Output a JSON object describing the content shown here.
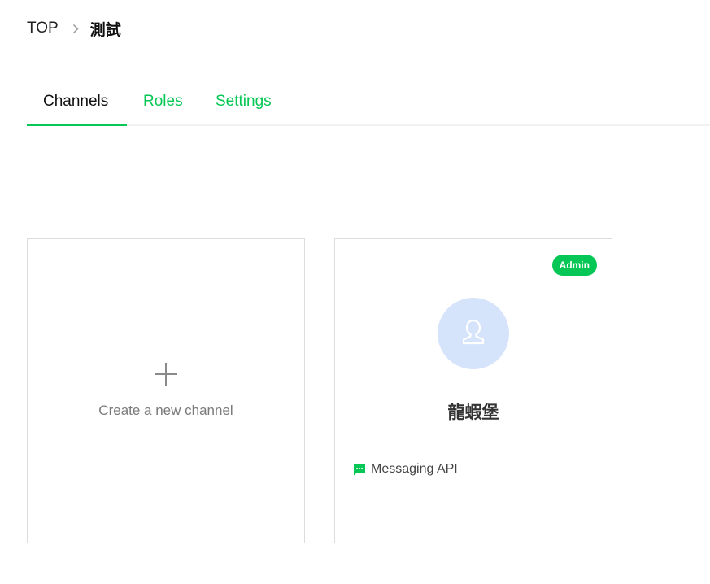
{
  "breadcrumb": {
    "root": "TOP",
    "separator_icon": "chevron-right-icon",
    "current": "測試"
  },
  "tabs": [
    {
      "label": "Channels",
      "active": true
    },
    {
      "label": "Roles",
      "active": false
    },
    {
      "label": "Settings",
      "active": false
    }
  ],
  "create_card": {
    "icon": "plus-icon",
    "label": "Create a new channel"
  },
  "channel_card": {
    "badge": "Admin",
    "avatar_icon": "user-icon",
    "name": "龍蝦堡",
    "type_icon": "message-icon",
    "type_label": "Messaging API"
  },
  "colors": {
    "accent": "#06c755",
    "avatar_bg": "#d5e3fb",
    "card_border": "#dcdcdc"
  }
}
